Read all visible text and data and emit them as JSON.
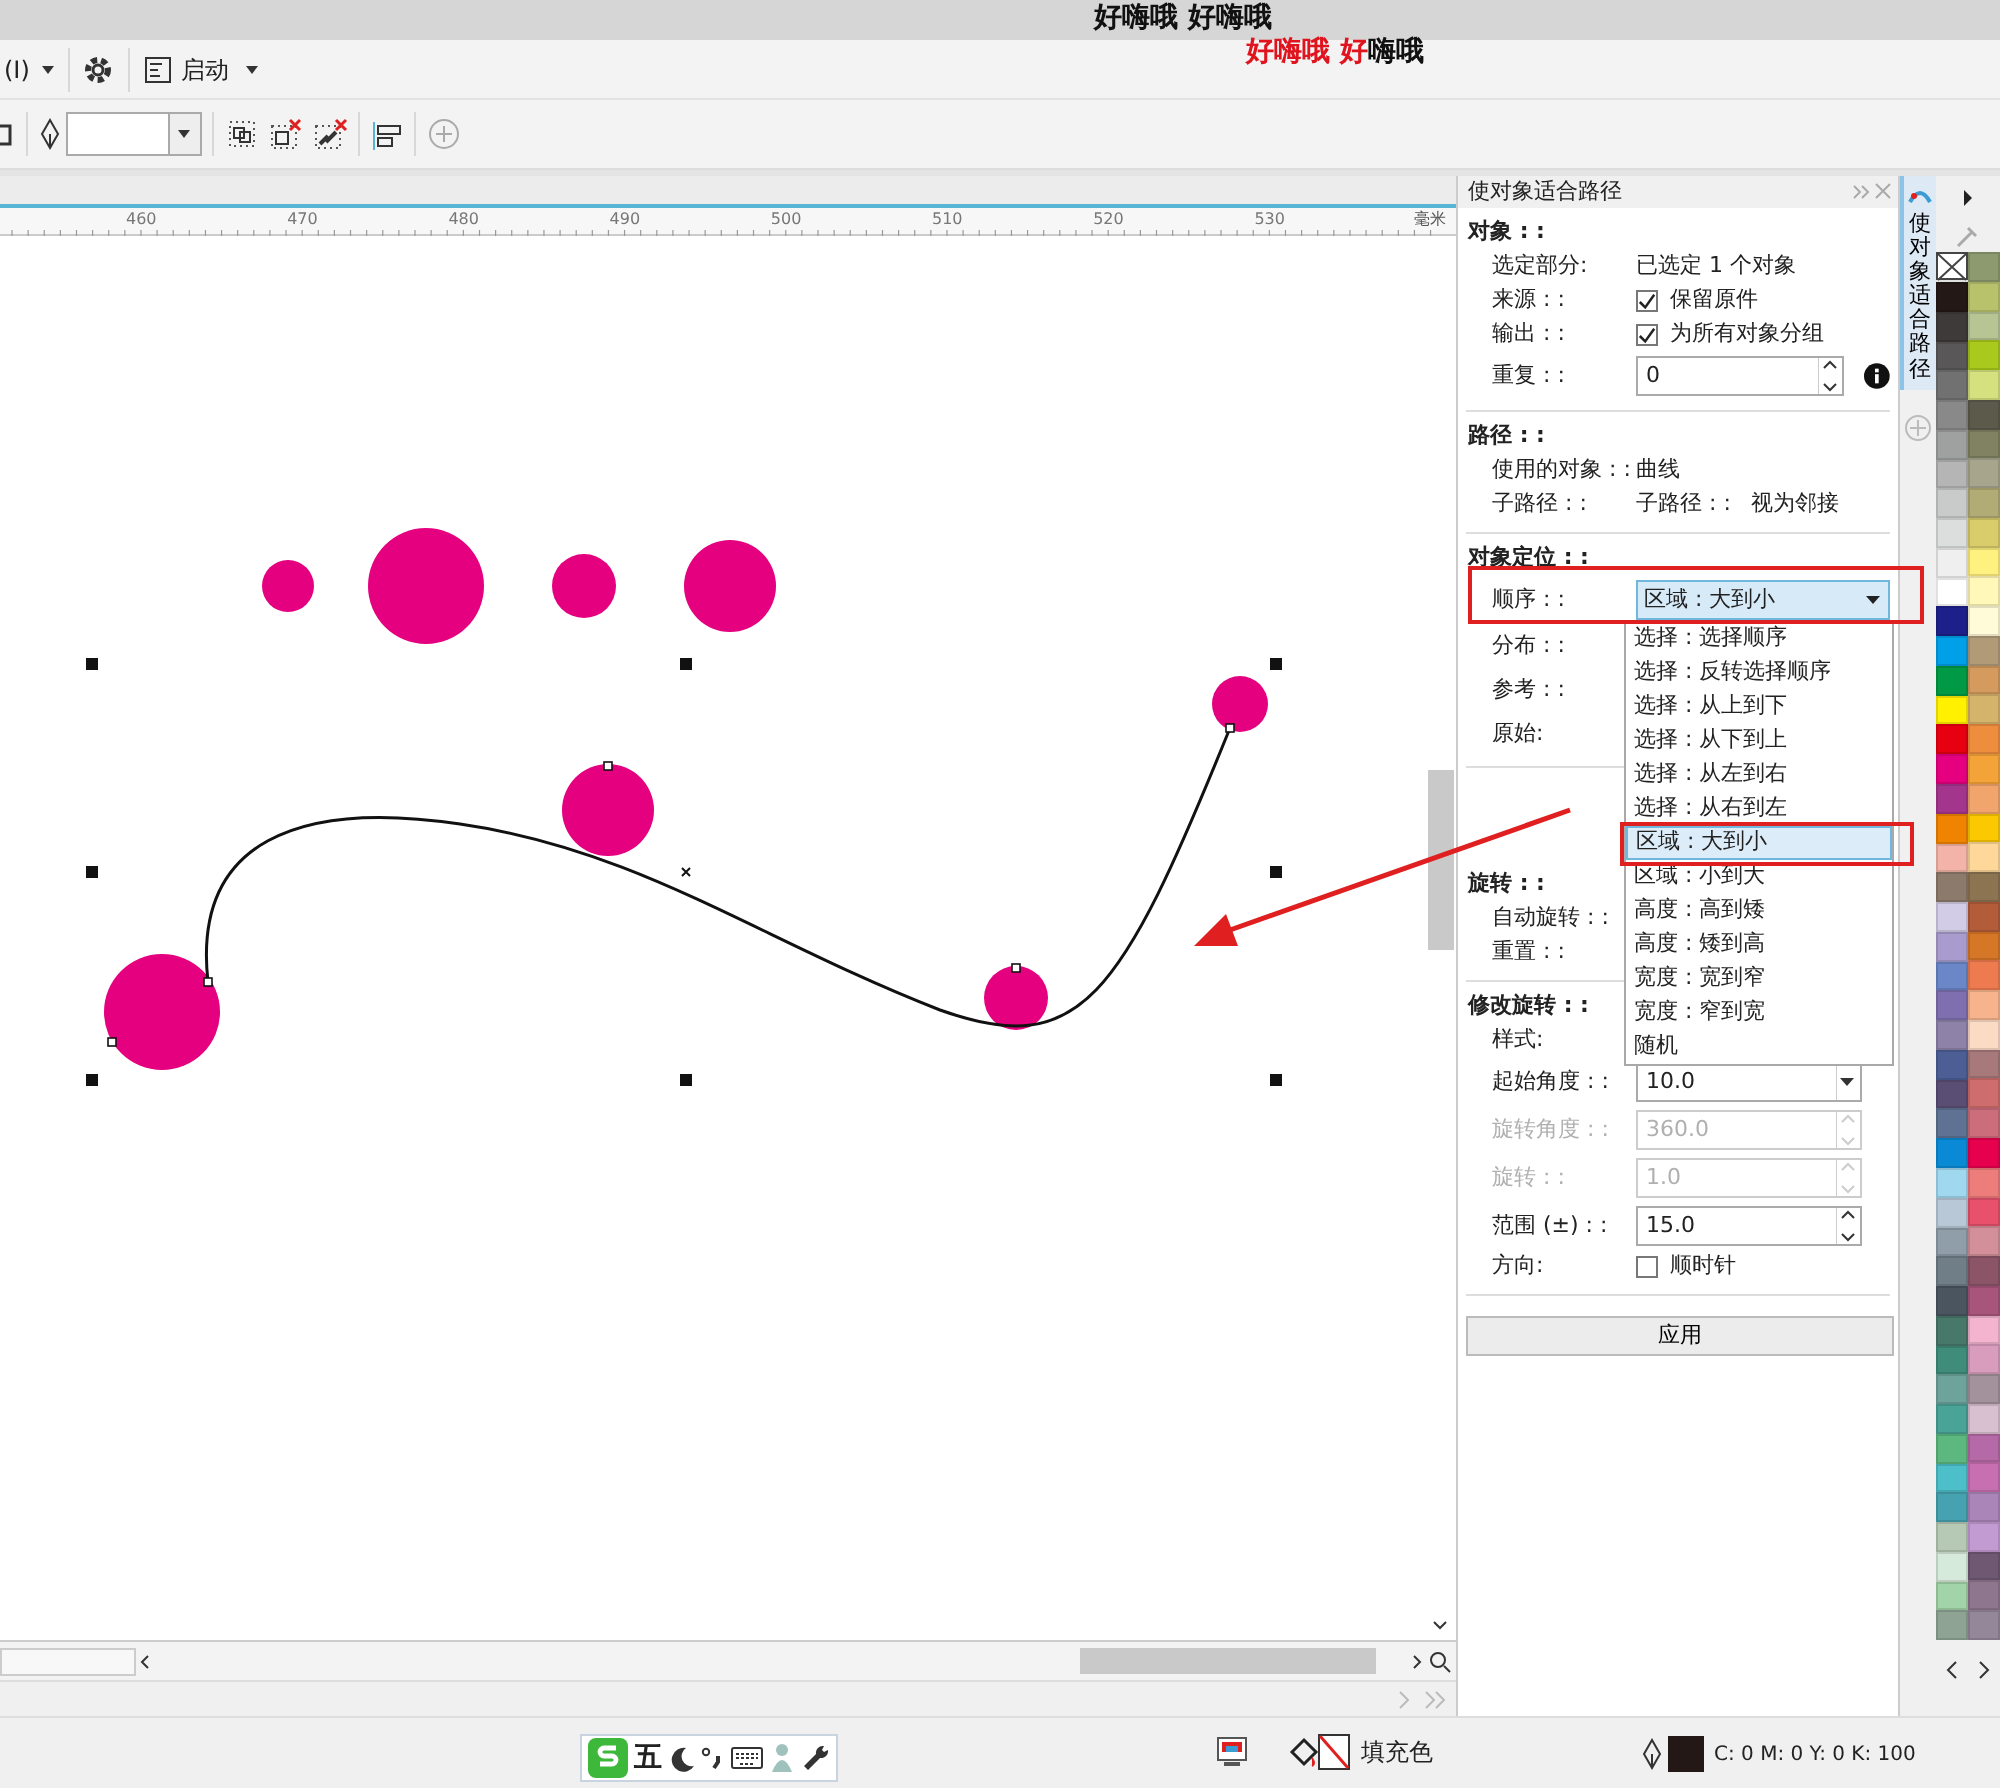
{
  "caption": [
    [
      {
        "text": "好嗨哦 好嗨哦",
        "color": "#111111"
      }
    ],
    [
      {
        "text": "好嗨哦 好",
        "color": "#e0141e"
      },
      {
        "text": "嗨哦",
        "color": "#111111"
      }
    ]
  ],
  "toolbar": {
    "menu_fragment": "(I)",
    "launch_label": "启动"
  },
  "ruler": {
    "labels": [
      "460",
      "470",
      "480",
      "490",
      "500",
      "510",
      "520",
      "530"
    ],
    "unit": "毫米"
  },
  "docker": {
    "title": "使对象适合路径",
    "sections": [
      {
        "title": "对象 : :",
        "rows": [
          {
            "kind": "text",
            "label": "选定部分:",
            "value": "已选定 1 个对象"
          },
          {
            "kind": "check",
            "label": "来源 : :",
            "value": "保留原件",
            "checked": true
          },
          {
            "kind": "check",
            "label": "输出 : :",
            "value": "为所有对象分组",
            "checked": true
          },
          {
            "kind": "spin",
            "label": "重复 : :",
            "value": "0",
            "info": true
          }
        ]
      },
      {
        "title": "路径 : :",
        "rows": [
          {
            "kind": "text",
            "label": "使用的对象 : :",
            "value": "曲线"
          },
          {
            "kind": "text",
            "label": "子路径 : :",
            "value": "子路径 : :",
            "extra": "视为邻接"
          }
        ]
      },
      {
        "title": "对象定位 : :",
        "rows": [
          {
            "kind": "select",
            "label": "顺序 : :",
            "value": "区域 : 大到小"
          },
          {
            "kind": "label",
            "label": "分布 : :"
          },
          {
            "kind": "label",
            "label": "参考 : :"
          },
          {
            "kind": "label",
            "label": "原始:"
          }
        ]
      },
      {
        "title": "旋转 : :",
        "rows": [
          {
            "kind": "label",
            "label": "自动旋转 : :"
          },
          {
            "kind": "label",
            "label": "重置 : :"
          }
        ]
      },
      {
        "title": "修改旋转 : :",
        "rows": [
          {
            "kind": "label",
            "label": "样式:"
          },
          {
            "kind": "combo",
            "label": "起始角度 : :",
            "value": "10.0"
          },
          {
            "kind": "spin",
            "label": "旋转角度 : :",
            "value": "360.0",
            "disabled": true
          },
          {
            "kind": "spin",
            "label": "旋转 : :",
            "value": "1.0",
            "disabled": true
          },
          {
            "kind": "spin",
            "label": "范围 (±) : :",
            "value": "15.0"
          },
          {
            "kind": "check",
            "label": "方向:",
            "value": "顺时针",
            "checked": false
          }
        ]
      }
    ],
    "apply_label": "应用"
  },
  "dropdown": {
    "items": [
      {
        "label": "选择 : 选择顺序",
        "selected": false
      },
      {
        "label": "选择 : 反转选择顺序",
        "selected": false
      },
      {
        "label": "选择 : 从上到下",
        "selected": false
      },
      {
        "label": "选择 : 从下到上",
        "selected": false
      },
      {
        "label": "选择 : 从左到右",
        "selected": false
      },
      {
        "label": "选择 : 从右到左",
        "selected": false
      },
      {
        "label": "区域 : 大到小",
        "selected": true
      },
      {
        "label": "区域 : 小到大",
        "selected": false
      },
      {
        "label": "高度 : 高到矮",
        "selected": false
      },
      {
        "label": "高度 : 矮到高",
        "selected": false
      },
      {
        "label": "宽度 : 宽到窄",
        "selected": false
      },
      {
        "label": "宽度 : 窄到宽",
        "selected": false
      },
      {
        "label": "随机",
        "selected": false
      }
    ]
  },
  "vertical_tab": "使对象适合路径",
  "palette": {
    "columns": [
      [
        {
          "kind": "none"
        },
        {
          "color": "#231815"
        },
        {
          "color": "#3e3a39"
        },
        {
          "color": "#595757"
        },
        {
          "color": "#727171"
        },
        {
          "color": "#898989"
        },
        {
          "color": "#9fa0a0"
        },
        {
          "color": "#b5b5b6"
        },
        {
          "color": "#c9caca"
        },
        {
          "color": "#dcdddd"
        },
        {
          "color": "#efefef"
        },
        {
          "color": "#ffffff"
        },
        {
          "color": "#1d2088"
        },
        {
          "color": "#00a0e9"
        },
        {
          "color": "#009944"
        },
        {
          "color": "#fff100"
        },
        {
          "color": "#e60012"
        },
        {
          "color": "#e4007f"
        },
        {
          "color": "#a4358c"
        },
        {
          "color": "#f08300"
        },
        {
          "color": "#f4b3a8"
        },
        {
          "color": "#8c7a6b"
        },
        {
          "color": "#d3cce6"
        },
        {
          "color": "#a99bcd"
        },
        {
          "color": "#6b87c8"
        },
        {
          "color": "#7f6fb0"
        },
        {
          "color": "#8e82a8"
        },
        {
          "color": "#4c5e94"
        },
        {
          "color": "#5a4e74"
        },
        {
          "color": "#5f7293"
        },
        {
          "color": "#0a8ad4"
        },
        {
          "color": "#a0d8ef"
        },
        {
          "color": "#b9c8d6"
        },
        {
          "color": "#8f9ea8"
        },
        {
          "color": "#6f7e87"
        },
        {
          "color": "#4b5560"
        },
        {
          "color": "#487869"
        },
        {
          "color": "#3f8c7a"
        },
        {
          "color": "#6ea39b"
        },
        {
          "color": "#4aa397"
        },
        {
          "color": "#5cb87f"
        },
        {
          "color": "#4dbfc9"
        },
        {
          "color": "#46a2b0"
        },
        {
          "color": "#b5c9b5"
        },
        {
          "color": "#d6eadb"
        },
        {
          "color": "#a3d3a8"
        },
        {
          "color": "#8fa394"
        }
      ],
      [
        {
          "color": "#8d9a6f"
        },
        {
          "color": "#b8c26b"
        },
        {
          "color": "#b7c595"
        },
        {
          "color": "#a9c91c"
        },
        {
          "color": "#d4e17e"
        },
        {
          "color": "#5c5a4b"
        },
        {
          "color": "#808262"
        },
        {
          "color": "#a7a68c"
        },
        {
          "color": "#b1ab75"
        },
        {
          "color": "#d9cc6a"
        },
        {
          "color": "#fff17f"
        },
        {
          "color": "#fff8b8"
        },
        {
          "color": "#fffbd8"
        },
        {
          "color": "#b19a78"
        },
        {
          "color": "#d49a5e"
        },
        {
          "color": "#d4b36b"
        },
        {
          "color": "#ef8d3f"
        },
        {
          "color": "#f4a338"
        },
        {
          "color": "#f1a56c"
        },
        {
          "color": "#fcc800"
        },
        {
          "color": "#fdd89a"
        },
        {
          "color": "#8c7352"
        },
        {
          "color": "#b35c3a"
        },
        {
          "color": "#d67727"
        },
        {
          "color": "#ee7b4f"
        },
        {
          "color": "#f6b38d"
        },
        {
          "color": "#fcdbc5"
        },
        {
          "color": "#a8797a"
        },
        {
          "color": "#cf6d6c"
        },
        {
          "color": "#cc6d7b"
        },
        {
          "color": "#e6004e"
        },
        {
          "color": "#ed7d7b"
        },
        {
          "color": "#e8506b"
        },
        {
          "color": "#d3909a"
        },
        {
          "color": "#8b5567"
        },
        {
          "color": "#a8557c"
        },
        {
          "color": "#f4b4d0"
        },
        {
          "color": "#d89dbc"
        },
        {
          "color": "#a3919c"
        },
        {
          "color": "#d9c0d0"
        },
        {
          "color": "#b569a6"
        },
        {
          "color": "#c86fb1"
        },
        {
          "color": "#aa86b8"
        },
        {
          "color": "#c39bd3"
        },
        {
          "color": "#6f5872"
        },
        {
          "color": "#8e768e"
        },
        {
          "color": "#94879a"
        }
      ]
    ]
  },
  "status": {
    "ime_label": "五",
    "fill_label": "填充色",
    "outline_readout": "C: 0 M: 0 Y: 0 K: 100"
  }
}
